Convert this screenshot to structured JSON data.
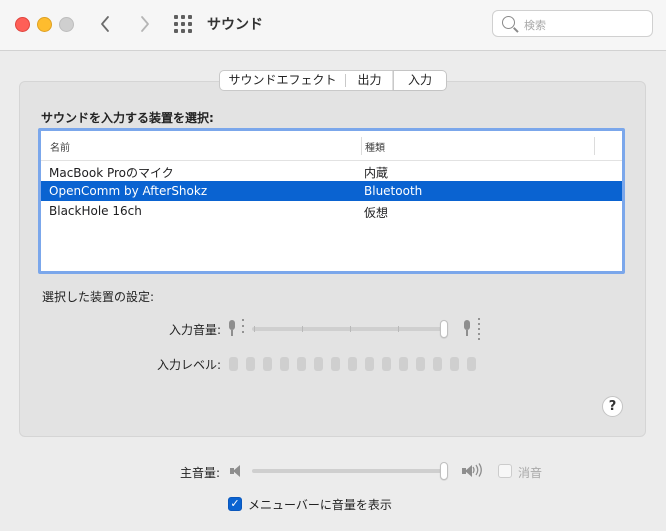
{
  "window": {
    "title": "サウンド"
  },
  "search": {
    "placeholder": "検索"
  },
  "tabs": [
    {
      "label": "サウンドエフェクト",
      "selected": false
    },
    {
      "label": "出力",
      "selected": false
    },
    {
      "label": "入力",
      "selected": true
    }
  ],
  "input": {
    "section_title": "サウンドを入力する装置を選択:",
    "columns": [
      "名前",
      "種類"
    ],
    "rows": [
      {
        "name": "MacBook Proのマイク",
        "type": "内蔵",
        "selected": false
      },
      {
        "name": "OpenComm by AfterShokz",
        "type": "Bluetooth",
        "selected": true
      },
      {
        "name": "BlackHole 16ch",
        "type": "仮想",
        "selected": false
      }
    ],
    "settings_title": "選択した装置の設定:",
    "volume_label": "入力音量:",
    "volume_level": 1.0,
    "level_label": "入力レベル:",
    "level_active_bars": 0,
    "level_bar_count": 15
  },
  "help": {
    "label": "?"
  },
  "main_volume": {
    "label": "主音量:",
    "level": 1.0,
    "mute_label": "消音",
    "mute_checked": false
  },
  "menubar": {
    "label": "メニューバーに音量を表示",
    "checked": true,
    "check_glyph": "✓"
  },
  "colors": {
    "accent": "#0a63d1",
    "focus_ring": "#7ba7eb"
  }
}
